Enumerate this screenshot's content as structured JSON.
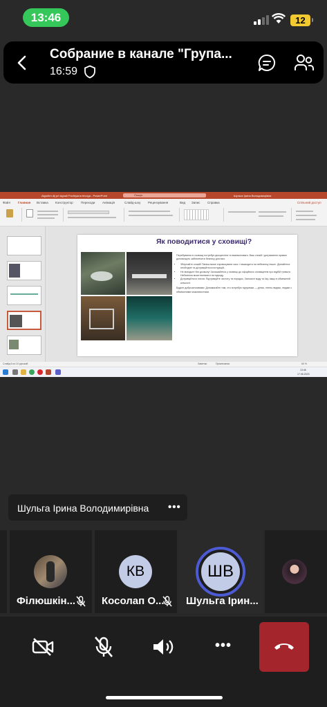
{
  "status_bar": {
    "time": "13:46",
    "battery": "12"
  },
  "meeting": {
    "title": "Собрание в канале \"Група...",
    "duration": "16:59"
  },
  "share_screen": {
    "app_title": "Algoritm dij pri signali Povitryana trivoga - PowerPoint",
    "search_placeholder": "Пошук",
    "user": "Шульга Ірина Володимирівна",
    "tabs": [
      "Файл",
      "Главная",
      "Вставка",
      "Конструктор",
      "Переходи",
      "Анімація",
      "Слайд-шоу",
      "Рецензування",
      "Вид",
      "Запис",
      "Справка"
    ],
    "share_label": "Спільний доступ",
    "slide": {
      "title": "Як поводитися у сховищі?",
      "paragraphs": [
        "Перебування в сховищі потребує дисципліни та взаємоповаги. Ваш спокій і дотримання правил допоможуть забезпечити безпеку для всіх.",
        "Зберігайте спокій! Паніка може спровокувати хаос і нашкодити на небезпеку інших. Дізнайтеся необхідне та дотримуйтеся інструкцій.",
        "Не виходьте без дозволу! Залишайтеся у сховищі до офіційного оповіщення про відбій тривоги. Небезпека може виникати на підходу.",
        "Дотримуйтеся гігієни: Підтримуйте чистоту та порядок. Заносьте воду та їжу, якщо в обмеженій кількості.",
        "Будьте доброзичливими: Допомагайте тим, хто потребує підтримки — дітям, літнім людям, людям з обмеженими можливостями."
      ]
    },
    "status_left": "Слайд 6 из 10   русский",
    "status_notes": "Заметки",
    "status_comments": "Примечания",
    "zoom": "60 %",
    "clock_time": "13:46",
    "clock_date": "17.06.2023"
  },
  "speaker": {
    "name": "Шульга Ірина Володимирівна",
    "more": "•••"
  },
  "participants": [
    {
      "name": "Філюшкін...",
      "initials": "",
      "muted": true
    },
    {
      "name": "Косолап О...",
      "initials": "КВ",
      "muted": true
    },
    {
      "name": "Шульга Ірин...",
      "initials": "ШВ",
      "muted": false
    },
    {
      "name": "",
      "initials": "",
      "muted": false
    }
  ],
  "controls": {
    "more": "•••"
  },
  "colors": {
    "accent_green": "#35c759",
    "hangup_red": "#a4262c",
    "avatar_blue": "#c3cce6",
    "speaking_ring": "#4c5bd4",
    "powerpoint": "#b7472a"
  }
}
